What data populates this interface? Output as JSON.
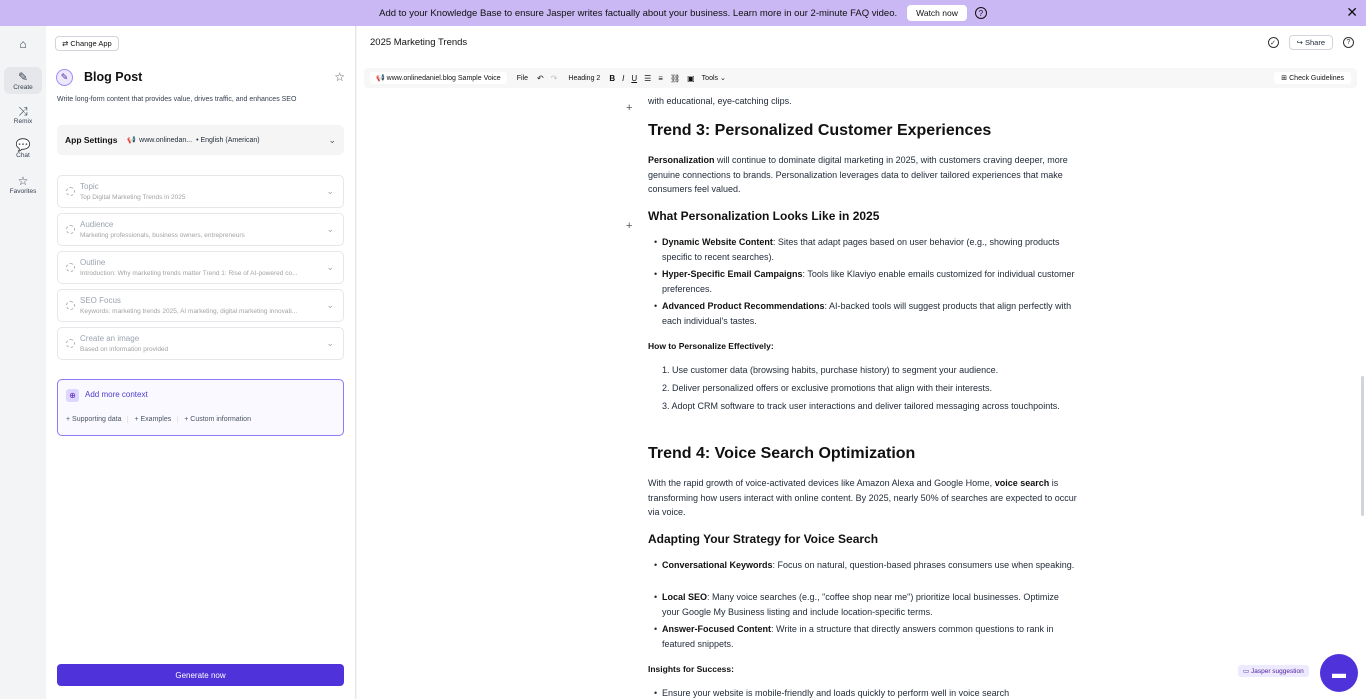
{
  "banner": {
    "text": "Add to your Knowledge Base to ensure Jasper writes factually about your business. Learn more in our 2-minute FAQ video.",
    "watch_label": "Watch now",
    "help_icon": "question-circle-icon",
    "close_icon": "close-icon"
  },
  "rail": {
    "items": [
      {
        "label": "",
        "icon": "home-icon"
      },
      {
        "label": "Create",
        "icon": "pencil-icon"
      },
      {
        "label": "Remix",
        "icon": "shuffle-icon"
      },
      {
        "label": "Chat",
        "icon": "chat-icon"
      },
      {
        "label": "Favorites",
        "icon": "star-icon"
      }
    ]
  },
  "panel": {
    "change_app": "Change App",
    "app_title": "Blog Post",
    "app_desc": "Write long-form content that provides value, drives traffic, and enhances SEO",
    "settings_label": "App Settings",
    "settings_voice": "www.onlinedan...",
    "settings_lang": "• English (American)",
    "fields": [
      {
        "label": "Topic",
        "value": "Top Digital Marketing Trends in 2025"
      },
      {
        "label": "Audience",
        "value": "Marketing professionals, business owners, entrepreneurs"
      },
      {
        "label": "Outline",
        "value": "Introduction: Why marketing trends matter Trend 1: Rise of AI-powered co..."
      },
      {
        "label": "SEO Focus",
        "value": "Keywords: marketing trends 2025, AI marketing, digital marketing innovati..."
      },
      {
        "label": "Create an image",
        "value": "Based on information provided"
      }
    ],
    "context_title": "Add more context",
    "context_options": [
      "+ Supporting data",
      "+ Examples",
      "+ Custom information"
    ],
    "generate_label": "Generate now"
  },
  "main": {
    "doc_title": "2025 Marketing Trends",
    "share_label": "Share",
    "toolbar": {
      "voice": "www.onlinedaniel.blog Sample Voice",
      "file": "File",
      "heading": "Heading 2",
      "tools": "Tools",
      "check": "Check Guidelines"
    },
    "content": {
      "intro_tail": "with educational, eye-catching clips.",
      "t3_title": "Trend 3: Personalized Customer Experiences",
      "t3_p_b1": "Personalization",
      "t3_p_r1": " will continue to dominate digital marketing in 2025, with customers craving deeper, more genuine connections to brands. Personalization leverages data to deliver tailored experiences that make consumers feel valued.",
      "t3_h2": "What Personalization Looks Like in 2025",
      "t3_bullets": [
        {
          "bold": "Dynamic Website Content",
          "text": ": Sites that adapt pages based on user behavior (e.g., showing products specific to recent searches)."
        },
        {
          "bold": "Hyper-Specific Email Campaigns",
          "text": ": Tools like Klaviyo enable emails customized for individual customer preferences."
        },
        {
          "bold": "Advanced Product Recommendations",
          "text": ": AI-backed tools will suggest products that align perfectly with each individual's tastes."
        }
      ],
      "t3_h3": "How to Personalize Effectively:",
      "t3_steps": [
        "1.  Use customer data (browsing habits, purchase history) to segment your audience.",
        "2.  Deliver personalized offers or exclusive promotions that align with their interests.",
        "3.  Adopt CRM software to track user interactions and deliver tailored messaging across touchpoints."
      ],
      "t4_title": "Trend 4: Voice Search Optimization",
      "t4_p_r1": "With the rapid growth of voice-activated devices like Amazon Alexa and Google Home, ",
      "t4_p_b1": "voice search",
      "t4_p_r2": " is transforming how users interact with online content. By 2025, nearly 50% of searches are expected to occur via voice.",
      "t4_h2": "Adapting Your Strategy for Voice Search",
      "t4_bullets": [
        {
          "bold": "Conversational Keywords",
          "text": ": Focus on natural, question-based phrases consumers use when speaking."
        },
        {
          "bold": "Local SEO",
          "text": ": Many voice searches (e.g., \"coffee shop near me\") prioritize local businesses. Optimize your Google My Business listing and include location-specific terms."
        },
        {
          "bold": "Answer-Focused Content",
          "text": ": Write in a structure that directly answers common questions to rank in featured snippets."
        }
      ],
      "t4_h3": "Insights for Success:",
      "t4_last": "Ensure your website is mobile-friendly and loads quickly to perform well in voice search"
    },
    "suggestion_label": "Jasper suggestion"
  },
  "colors": {
    "accent": "#4f32d9",
    "banner": "#c9b8f3"
  }
}
